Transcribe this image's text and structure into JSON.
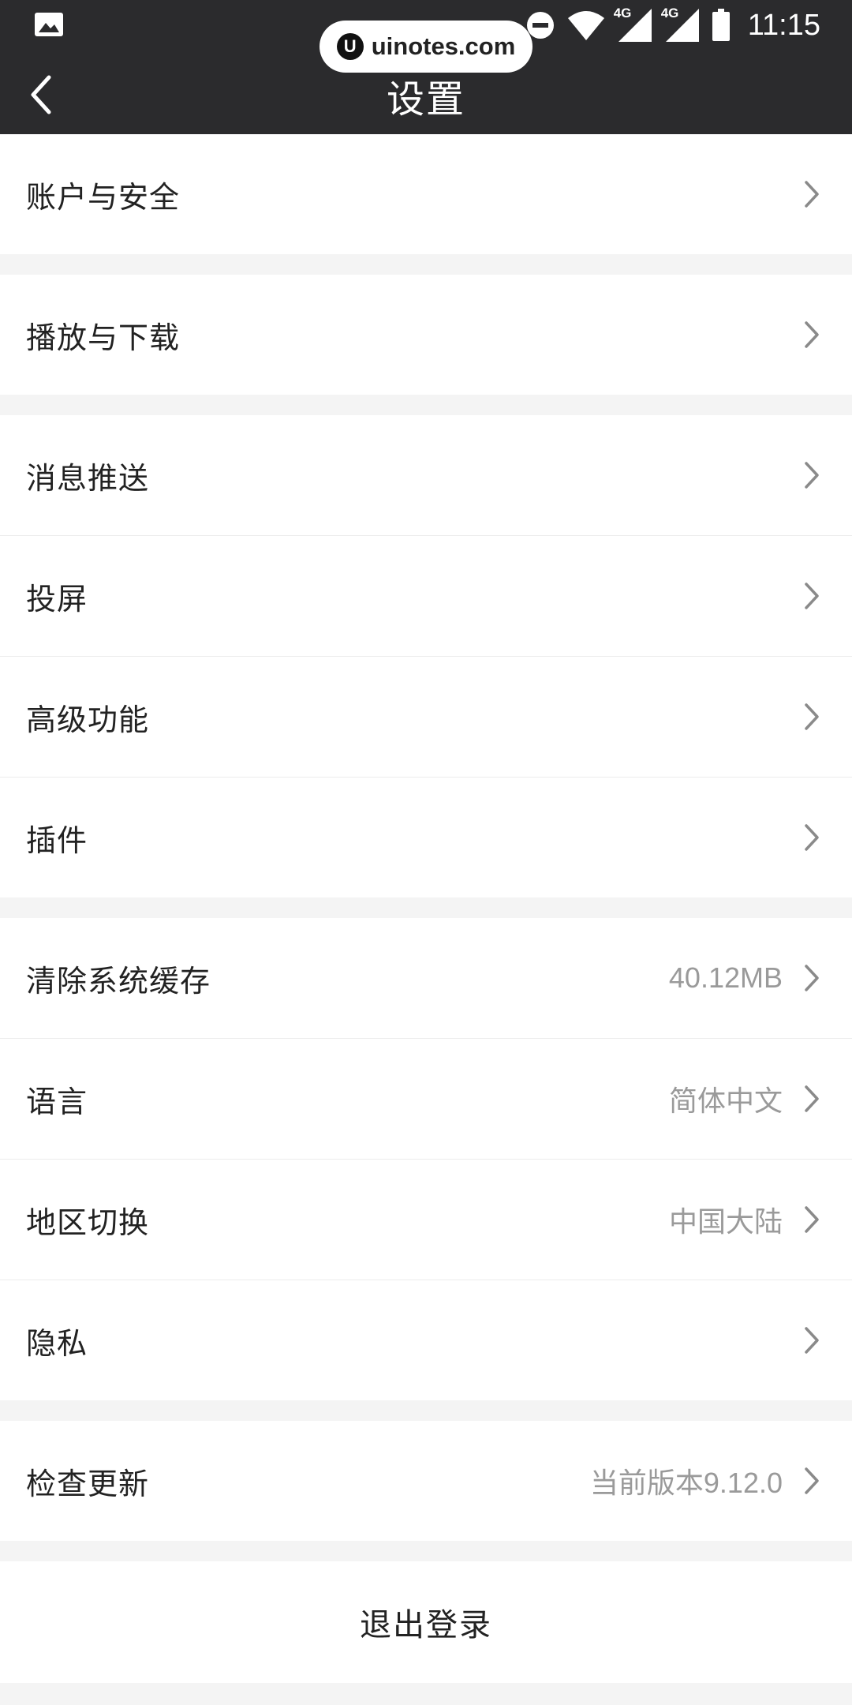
{
  "status_bar": {
    "time": "11:15",
    "net_1": "4G",
    "net_2": "4G",
    "icons": [
      "image-icon",
      "dnd-icon",
      "wifi-icon",
      "signal-icon",
      "signal-icon",
      "battery-icon"
    ]
  },
  "watermark": {
    "logo_text": "U",
    "text": "uinotes.com"
  },
  "header": {
    "title": "设置",
    "back_icon": "chevron-left-icon"
  },
  "groups": [
    {
      "items": [
        {
          "label": "账户与安全",
          "value": ""
        }
      ]
    },
    {
      "items": [
        {
          "label": "播放与下载",
          "value": ""
        }
      ]
    },
    {
      "items": [
        {
          "label": "消息推送",
          "value": ""
        },
        {
          "label": "投屏",
          "value": ""
        },
        {
          "label": "高级功能",
          "value": ""
        },
        {
          "label": "插件",
          "value": ""
        }
      ]
    },
    {
      "items": [
        {
          "label": "清除系统缓存",
          "value": "40.12MB"
        },
        {
          "label": "语言",
          "value": "简体中文"
        },
        {
          "label": "地区切换",
          "value": "中国大陆"
        },
        {
          "label": "隐私",
          "value": ""
        }
      ]
    },
    {
      "items": [
        {
          "label": "检查更新",
          "value": "当前版本9.12.0"
        }
      ]
    }
  ],
  "logout": {
    "label": "退出登录"
  },
  "colors": {
    "header_bg": "#2b2b2d",
    "page_bg": "#f4f4f4",
    "value_text": "#9a9a9a"
  }
}
